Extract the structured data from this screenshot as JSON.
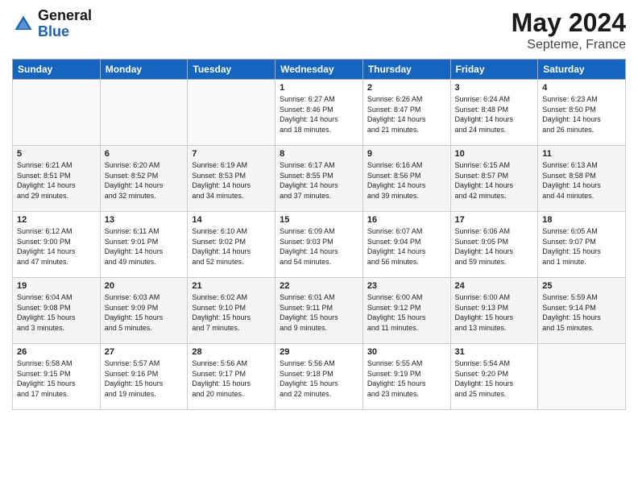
{
  "header": {
    "logo_general": "General",
    "logo_blue": "Blue",
    "title": "May 2024",
    "location": "Septeme, France"
  },
  "days_of_week": [
    "Sunday",
    "Monday",
    "Tuesday",
    "Wednesday",
    "Thursday",
    "Friday",
    "Saturday"
  ],
  "weeks": [
    {
      "days": [
        {
          "num": "",
          "info": ""
        },
        {
          "num": "",
          "info": ""
        },
        {
          "num": "",
          "info": ""
        },
        {
          "num": "1",
          "info": "Sunrise: 6:27 AM\nSunset: 8:46 PM\nDaylight: 14 hours\nand 18 minutes."
        },
        {
          "num": "2",
          "info": "Sunrise: 6:26 AM\nSunset: 8:47 PM\nDaylight: 14 hours\nand 21 minutes."
        },
        {
          "num": "3",
          "info": "Sunrise: 6:24 AM\nSunset: 8:48 PM\nDaylight: 14 hours\nand 24 minutes."
        },
        {
          "num": "4",
          "info": "Sunrise: 6:23 AM\nSunset: 8:50 PM\nDaylight: 14 hours\nand 26 minutes."
        }
      ]
    },
    {
      "days": [
        {
          "num": "5",
          "info": "Sunrise: 6:21 AM\nSunset: 8:51 PM\nDaylight: 14 hours\nand 29 minutes."
        },
        {
          "num": "6",
          "info": "Sunrise: 6:20 AM\nSunset: 8:52 PM\nDaylight: 14 hours\nand 32 minutes."
        },
        {
          "num": "7",
          "info": "Sunrise: 6:19 AM\nSunset: 8:53 PM\nDaylight: 14 hours\nand 34 minutes."
        },
        {
          "num": "8",
          "info": "Sunrise: 6:17 AM\nSunset: 8:55 PM\nDaylight: 14 hours\nand 37 minutes."
        },
        {
          "num": "9",
          "info": "Sunrise: 6:16 AM\nSunset: 8:56 PM\nDaylight: 14 hours\nand 39 minutes."
        },
        {
          "num": "10",
          "info": "Sunrise: 6:15 AM\nSunset: 8:57 PM\nDaylight: 14 hours\nand 42 minutes."
        },
        {
          "num": "11",
          "info": "Sunrise: 6:13 AM\nSunset: 8:58 PM\nDaylight: 14 hours\nand 44 minutes."
        }
      ]
    },
    {
      "days": [
        {
          "num": "12",
          "info": "Sunrise: 6:12 AM\nSunset: 9:00 PM\nDaylight: 14 hours\nand 47 minutes."
        },
        {
          "num": "13",
          "info": "Sunrise: 6:11 AM\nSunset: 9:01 PM\nDaylight: 14 hours\nand 49 minutes."
        },
        {
          "num": "14",
          "info": "Sunrise: 6:10 AM\nSunset: 9:02 PM\nDaylight: 14 hours\nand 52 minutes."
        },
        {
          "num": "15",
          "info": "Sunrise: 6:09 AM\nSunset: 9:03 PM\nDaylight: 14 hours\nand 54 minutes."
        },
        {
          "num": "16",
          "info": "Sunrise: 6:07 AM\nSunset: 9:04 PM\nDaylight: 14 hours\nand 56 minutes."
        },
        {
          "num": "17",
          "info": "Sunrise: 6:06 AM\nSunset: 9:05 PM\nDaylight: 14 hours\nand 59 minutes."
        },
        {
          "num": "18",
          "info": "Sunrise: 6:05 AM\nSunset: 9:07 PM\nDaylight: 15 hours\nand 1 minute."
        }
      ]
    },
    {
      "days": [
        {
          "num": "19",
          "info": "Sunrise: 6:04 AM\nSunset: 9:08 PM\nDaylight: 15 hours\nand 3 minutes."
        },
        {
          "num": "20",
          "info": "Sunrise: 6:03 AM\nSunset: 9:09 PM\nDaylight: 15 hours\nand 5 minutes."
        },
        {
          "num": "21",
          "info": "Sunrise: 6:02 AM\nSunset: 9:10 PM\nDaylight: 15 hours\nand 7 minutes."
        },
        {
          "num": "22",
          "info": "Sunrise: 6:01 AM\nSunset: 9:11 PM\nDaylight: 15 hours\nand 9 minutes."
        },
        {
          "num": "23",
          "info": "Sunrise: 6:00 AM\nSunset: 9:12 PM\nDaylight: 15 hours\nand 11 minutes."
        },
        {
          "num": "24",
          "info": "Sunrise: 6:00 AM\nSunset: 9:13 PM\nDaylight: 15 hours\nand 13 minutes."
        },
        {
          "num": "25",
          "info": "Sunrise: 5:59 AM\nSunset: 9:14 PM\nDaylight: 15 hours\nand 15 minutes."
        }
      ]
    },
    {
      "days": [
        {
          "num": "26",
          "info": "Sunrise: 5:58 AM\nSunset: 9:15 PM\nDaylight: 15 hours\nand 17 minutes."
        },
        {
          "num": "27",
          "info": "Sunrise: 5:57 AM\nSunset: 9:16 PM\nDaylight: 15 hours\nand 19 minutes."
        },
        {
          "num": "28",
          "info": "Sunrise: 5:56 AM\nSunset: 9:17 PM\nDaylight: 15 hours\nand 20 minutes."
        },
        {
          "num": "29",
          "info": "Sunrise: 5:56 AM\nSunset: 9:18 PM\nDaylight: 15 hours\nand 22 minutes."
        },
        {
          "num": "30",
          "info": "Sunrise: 5:55 AM\nSunset: 9:19 PM\nDaylight: 15 hours\nand 23 minutes."
        },
        {
          "num": "31",
          "info": "Sunrise: 5:54 AM\nSunset: 9:20 PM\nDaylight: 15 hours\nand 25 minutes."
        },
        {
          "num": "",
          "info": ""
        }
      ]
    }
  ]
}
